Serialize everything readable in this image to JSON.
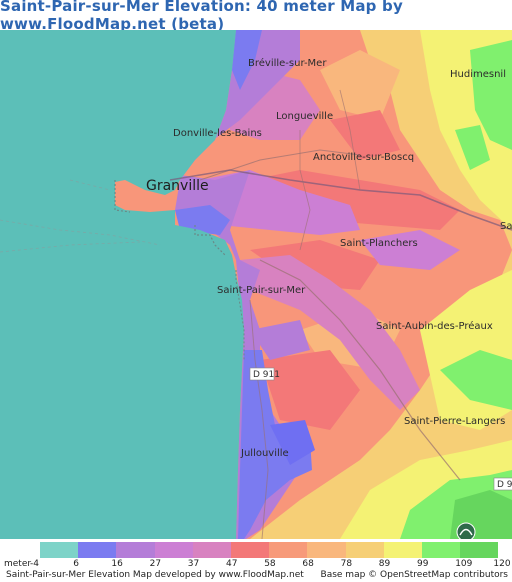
{
  "title": "Saint-Pair-sur-Mer Elevation: 40 meter Map by www.FloodMap.net (beta)",
  "map": {
    "places": {
      "breville": "Bréville-sur-Mer",
      "hudimesnil": "Hudimesnil",
      "longueville": "Longueville",
      "donville": "Donville-les-Bains",
      "anctoville": "Anctoville-sur-Boscq",
      "granville": "Granville",
      "saint_planchers": "Saint-Planchers",
      "sa": "Sa",
      "saint_pair": "Saint-Pair-sur-Mer",
      "saint_aubin": "Saint-Aubin-des-Préaux",
      "saint_pierre": "Saint-Pierre-Langers",
      "jullouville": "Jullouville"
    },
    "roads": {
      "d911": "D 911",
      "d9": "D 9"
    },
    "colors": {
      "sea": "#5cbfb8",
      "blue": "#6a6ff0",
      "purple": "#b27ad6",
      "magenta": "#d67ec9",
      "pink": "#e27da0",
      "red": "#f47a7a",
      "salmon": "#f8967a",
      "orange": "#fcb57a",
      "yellow_orange": "#f5d27a",
      "yellow": "#f3ef74",
      "green": "#7ff06a",
      "dark_green": "#5fcf55"
    }
  },
  "legend": {
    "label": "meter",
    "ticks": [
      "-4",
      "6",
      "16",
      "27",
      "37",
      "47",
      "58",
      "68",
      "78",
      "89",
      "99",
      "109",
      "120"
    ],
    "colors": [
      "#7dd3c8",
      "#7b7bf0",
      "#b47dd8",
      "#cc7fd4",
      "#d882c0",
      "#f37878",
      "#f79a7a",
      "#f9b77d",
      "#f6cf76",
      "#f4f274",
      "#80f06e",
      "#66d65e"
    ]
  },
  "footer": {
    "left": "Saint-Pair-sur-Mer Elevation Map developed by www.FloodMap.net",
    "right": "Base map © OpenStreetMap contributors"
  }
}
